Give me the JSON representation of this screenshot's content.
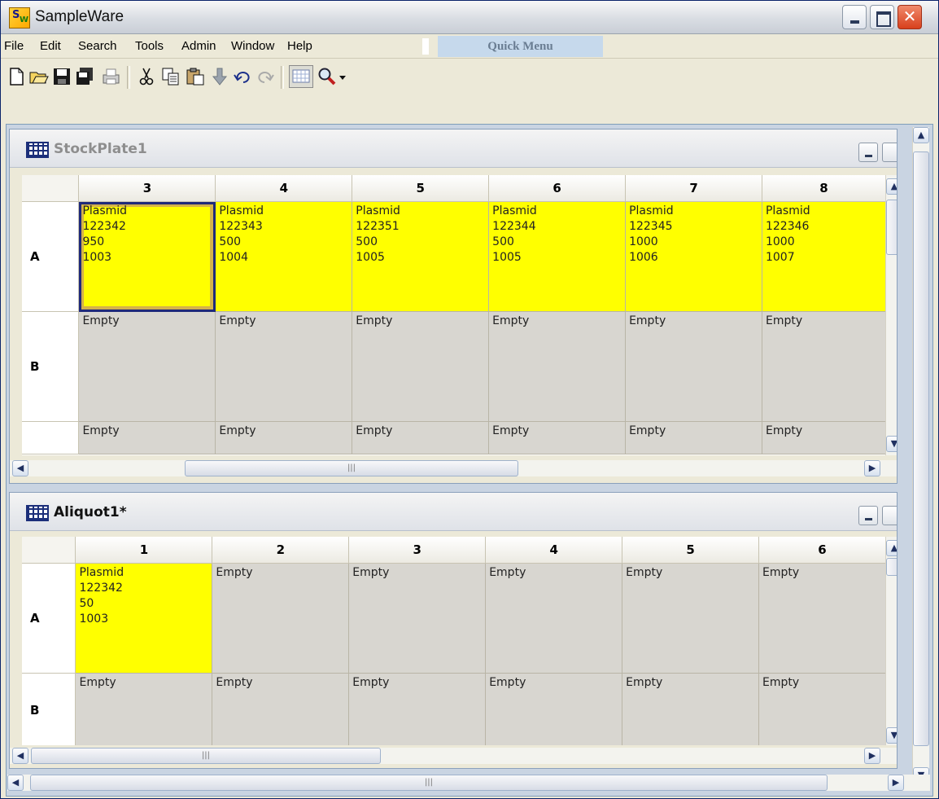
{
  "app": {
    "title": "SampleWare",
    "logo_s": "S",
    "logo_w": "W"
  },
  "window_controls": {
    "close_glyph": "✕"
  },
  "menu": {
    "items": [
      "File",
      "Edit",
      "Search",
      "Tools",
      "Admin",
      "Window",
      "Help"
    ],
    "quick_menu": "Quick Menu"
  },
  "toolbar": {
    "icons": [
      "new-document-icon",
      "open-folder-icon",
      "save-icon",
      "save-all-icon",
      "print-icon",
      "cut-icon",
      "copy-icon",
      "paste-icon",
      "move-down-icon",
      "undo-icon",
      "redo-icon",
      "plate-view-icon",
      "zoom-icon",
      "dropdown-arrow-icon"
    ]
  },
  "stock_plate": {
    "title": "StockPlate1",
    "columns": [
      "3",
      "4",
      "5",
      "6",
      "7",
      "8"
    ],
    "rows": [
      {
        "label": "A",
        "wells": [
          {
            "text": "Plasmid\n122342\n950\n1003",
            "filled": true,
            "selected": true
          },
          {
            "text": "Plasmid\n122343\n500\n1004",
            "filled": true
          },
          {
            "text": "Plasmid\n122351\n500\n1005",
            "filled": true
          },
          {
            "text": "Plasmid\n122344\n500\n1005",
            "filled": true
          },
          {
            "text": "Plasmid\n122345\n1000\n1006",
            "filled": true
          },
          {
            "text": "Plasmid\n122346\n1000\n1007",
            "filled": true
          }
        ]
      },
      {
        "label": "B",
        "wells": [
          {
            "text": "Empty"
          },
          {
            "text": "Empty"
          },
          {
            "text": "Empty"
          },
          {
            "text": "Empty"
          },
          {
            "text": "Empty"
          },
          {
            "text": "Empty"
          }
        ]
      },
      {
        "label": "",
        "wells": [
          {
            "text": "Empty"
          },
          {
            "text": "Empty"
          },
          {
            "text": "Empty"
          },
          {
            "text": "Empty"
          },
          {
            "text": "Empty"
          },
          {
            "text": "Empty"
          }
        ]
      }
    ]
  },
  "aliquot_plate": {
    "title": "Aliquot1*",
    "columns": [
      "1",
      "2",
      "3",
      "4",
      "5",
      "6"
    ],
    "rows": [
      {
        "label": "A",
        "wells": [
          {
            "text": "Plasmid\n122342\n50\n1003",
            "filled": true
          },
          {
            "text": "Empty"
          },
          {
            "text": "Empty"
          },
          {
            "text": "Empty"
          },
          {
            "text": "Empty"
          },
          {
            "text": "Empty"
          }
        ]
      },
      {
        "label": "B",
        "wells": [
          {
            "text": "Empty"
          },
          {
            "text": "Empty"
          },
          {
            "text": "Empty"
          },
          {
            "text": "Empty"
          },
          {
            "text": "Empty"
          },
          {
            "text": "Empty"
          }
        ]
      }
    ]
  },
  "scroll_glyphs": {
    "up": "▲",
    "down": "▼",
    "left": "◀",
    "right": "▶",
    "grip": "|||"
  }
}
